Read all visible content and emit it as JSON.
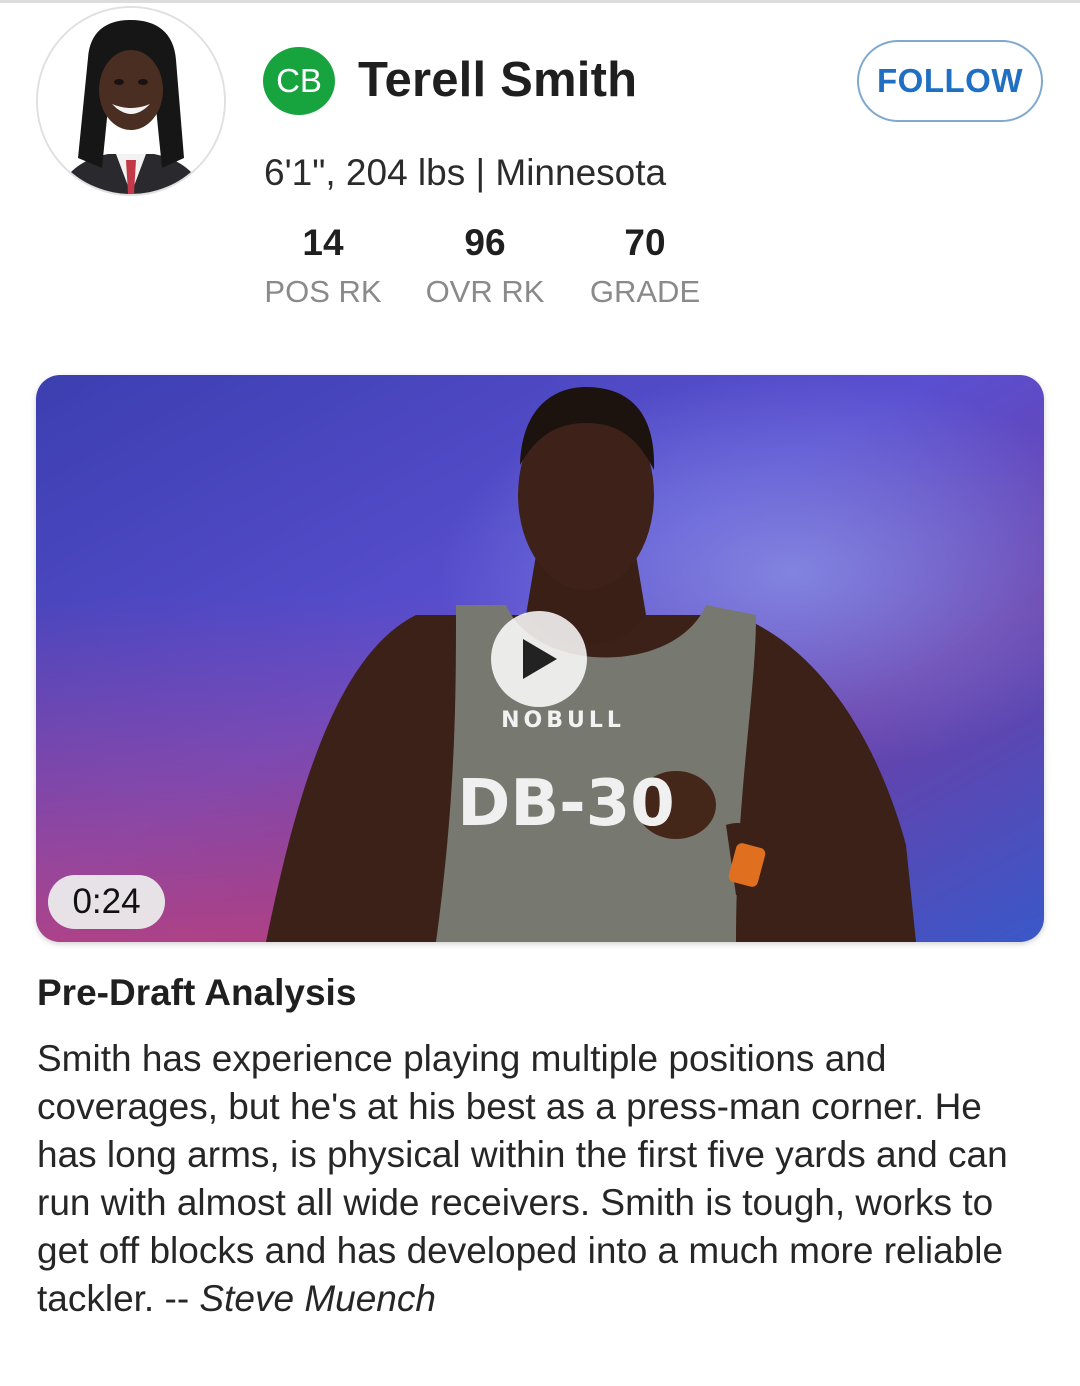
{
  "player": {
    "position": "CB",
    "name": "Terell Smith",
    "bio": "6'1\", 204 lbs | Minnesota",
    "follow_label": "FOLLOW"
  },
  "stats": [
    {
      "value": "14",
      "label": "POS RK"
    },
    {
      "value": "96",
      "label": "OVR RK"
    },
    {
      "value": "70",
      "label": "GRADE"
    }
  ],
  "video": {
    "duration": "0:24",
    "jersey_brand": "NOBULL",
    "jersey_number": "DB-30"
  },
  "analysis": {
    "title": "Pre-Draft Analysis",
    "body": "Smith has experience playing multiple positions and coverages, but he's at his best as a press-man corner. He has long arms, is physical within the first five yards and can run with almost all wide receivers. Smith is tough, works to get off blocks and has developed into a much more reliable tackler. -- ",
    "author": "Steve Muench"
  },
  "colors": {
    "position_badge": "#17a43f",
    "follow_text": "#1f6fc2",
    "follow_border": "#7fa9cf"
  }
}
